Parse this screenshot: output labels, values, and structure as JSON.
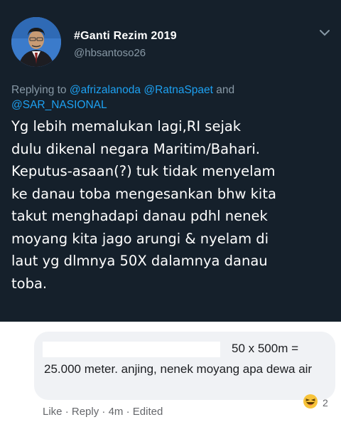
{
  "tweet": {
    "author_name": "#Ganti Rezim 2019",
    "author_handle": "@hbsantoso26",
    "reply_prefix": "Replying to",
    "reply_mention_1": "@afrizalanoda",
    "reply_mention_2": "@RatnaSpaet",
    "reply_and": "and",
    "reply_mention_3": "@SAR_NASIONAL",
    "body_lines": [
      "Yg lebih memalukan lagi,RI sejak",
      "dulu dikenal negara Maritim/Bahari.",
      "Keputus-asaan(?) tuk tidak menyelam",
      "ke danau toba mengesankan bhw kita",
      "takut menghadapi danau pdhl nenek",
      "moyang kita jago arungi & nyelam di",
      "laut yg dlmnya 50X dalamnya danau",
      "toba."
    ]
  },
  "comment": {
    "line1": "50 x 500m =",
    "text": "25.000 meter. anjing, nenek moyang apa dewa air",
    "reaction_count": "2",
    "like_label": "Like",
    "reply_label": "Reply",
    "time": "4m",
    "edited_label": "Edited",
    "separator": "·"
  },
  "icons": {
    "chevron": "chevron-down-icon",
    "reaction": "haha-emoji-icon"
  },
  "colors": {
    "tweet_bg": "#15202b",
    "mention": "#1da1f2",
    "muted": "#8899a6",
    "bubble_bg": "#f0f2f5"
  }
}
